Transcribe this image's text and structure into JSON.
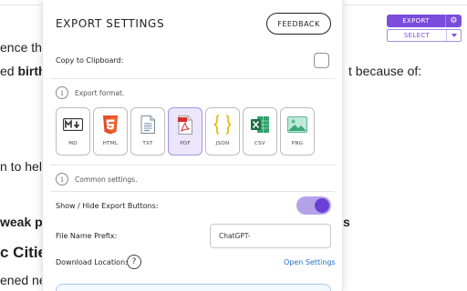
{
  "background": {
    "line1": "ence th",
    "line2_plain": "ed ",
    "line2_bold": "birth",
    "line2_end": "t because of:",
    "line3": "n to help",
    "line4_bold": "weak po",
    "line4_end": "s",
    "heading": "c Citie",
    "line5": "ened ne"
  },
  "widget": {
    "export_label": "EXPORT",
    "gear_icon": "gear-icon",
    "select_label": "SELECT"
  },
  "panel": {
    "title": "EXPORT SETTINGS",
    "feedback_label": "FEEDBACK",
    "copy_label": "Copy to Clipboard:",
    "export_format_label": "Export format.",
    "formats": [
      {
        "label": "MD",
        "icon": "markdown-icon"
      },
      {
        "label": "HTML",
        "icon": "html5-icon"
      },
      {
        "label": "TXT",
        "icon": "text-file-icon"
      },
      {
        "label": "PDF",
        "icon": "pdf-icon",
        "selected": true
      },
      {
        "label": "JSON",
        "icon": "json-braces-icon"
      },
      {
        "label": "CSV",
        "icon": "excel-icon"
      },
      {
        "label": "PNG",
        "icon": "image-icon"
      }
    ],
    "common_label": "Common settings.",
    "show_hide_label": "Show / Hide Export Buttons:",
    "toggle_on": true,
    "prefix_label": "File Name Prefix:",
    "prefix_value": "ChatGPT-",
    "download_label": "Download Location:",
    "help_glyph": "?",
    "open_settings_label": "Open Settings",
    "info_glyph": "i"
  },
  "colors": {
    "accent": "#7c4ddb",
    "selected_tile": "#ebe6fb",
    "link": "#1f6fc5"
  }
}
